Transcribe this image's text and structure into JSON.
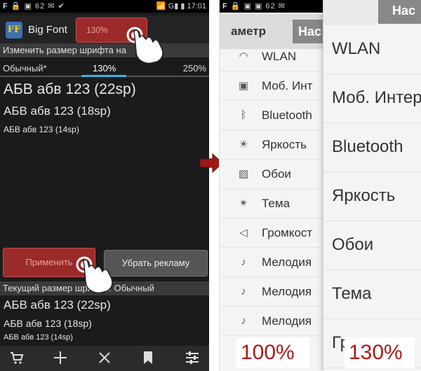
{
  "left": {
    "status": {
      "left": "F",
      "icons": "62",
      "right_signal": "G",
      "time": "17:01"
    },
    "app_logo": "FF",
    "app_title": "Big Font",
    "size_button": "130%",
    "hint": "Изменить размер шрифта на",
    "slider": {
      "left": "Обычный*",
      "mid": "130%",
      "right": "250%"
    },
    "samples": [
      "АБВ абв 123 (22sp)",
      "АБВ абв 123 (18sp)",
      "АБВ абв 123 (14sp)"
    ],
    "apply_button": "Применить",
    "remove_ads_button": "Убрать рекламу",
    "current_label": "Текущий размер шрифта: Обычный",
    "current_samples": [
      "АБВ абв 123 (22sp)",
      "АБВ абв 123 (18sp)",
      "АБВ абв 123 (14sp)"
    ]
  },
  "middle": {
    "status": {
      "left": "F",
      "icons": "62"
    },
    "tab1": "аметр",
    "tab2": "Нас",
    "items": [
      {
        "label": "WLAN",
        "icon": "wifi-icon"
      },
      {
        "label": "Моб. Инт",
        "icon": "mobile-data-icon"
      },
      {
        "label": "Bluetooth",
        "icon": "bluetooth-icon"
      },
      {
        "label": "Яркость",
        "icon": "brightness-icon"
      },
      {
        "label": "Обои",
        "icon": "wallpaper-icon"
      },
      {
        "label": "Тема",
        "icon": "theme-icon"
      },
      {
        "label": "Громкост",
        "icon": "volume-icon"
      },
      {
        "label": "Мелодия",
        "icon": "ringtone-icon"
      },
      {
        "label": "Мелодия",
        "icon": "ringtone-icon"
      },
      {
        "label": "Мелодия",
        "icon": "ringtone-icon"
      }
    ],
    "zoom": "100%"
  },
  "right": {
    "tab": "Нас",
    "items": [
      "WLAN",
      "Моб. Интер",
      "Bluetooth",
      "Яркость",
      "Обои",
      "Тема",
      "Громкост"
    ],
    "zoom": "130%"
  },
  "colors": {
    "accent_red": "#9b2a2a",
    "slider_blue": "#33b5e5",
    "zoom_red": "#b01818"
  }
}
